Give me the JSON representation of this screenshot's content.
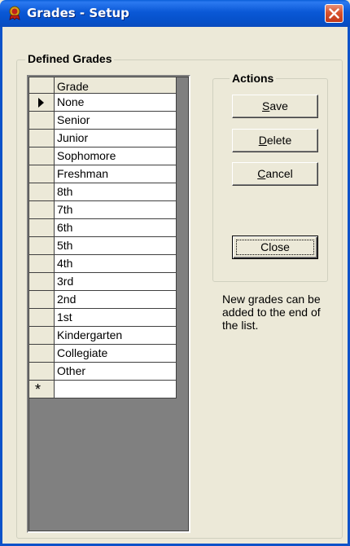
{
  "window": {
    "title": "Grades - Setup",
    "accent": "#0a58d6",
    "close_color": "#d8532e"
  },
  "grades_group": {
    "label": "Defined Grades",
    "column_header": "Grade",
    "rows": [
      {
        "value": "None",
        "current": true
      },
      {
        "value": "Senior"
      },
      {
        "value": "Junior"
      },
      {
        "value": "Sophomore"
      },
      {
        "value": "Freshman"
      },
      {
        "value": "8th"
      },
      {
        "value": "7th"
      },
      {
        "value": "6th"
      },
      {
        "value": "5th"
      },
      {
        "value": "4th"
      },
      {
        "value": "3rd"
      },
      {
        "value": "2nd"
      },
      {
        "value": "1st"
      },
      {
        "value": "Kindergarten"
      },
      {
        "value": "Collegiate"
      },
      {
        "value": "Other"
      }
    ],
    "new_row_marker": "*",
    "current_row_icon": "row-pointer-icon"
  },
  "actions_group": {
    "label": "Actions",
    "save": {
      "label_first": "S",
      "label_rest": "ave"
    },
    "delete": {
      "label_first": "D",
      "label_rest": "elete"
    },
    "cancel": {
      "label_first": "C",
      "label_rest": "ancel"
    },
    "close": {
      "label": "Close"
    }
  },
  "note": "New grades can be added to the end of the list."
}
